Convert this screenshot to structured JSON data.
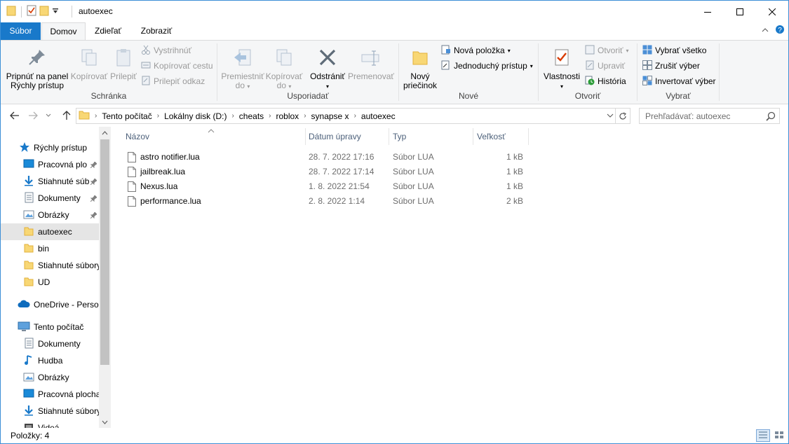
{
  "window": {
    "title": "autoexec",
    "accent": "#1979ca"
  },
  "ribbon_tabs": {
    "file": "Súbor",
    "home": "Domov",
    "share": "Zdieľať",
    "view": "Zobraziť"
  },
  "ribbon": {
    "clipboard": {
      "title": "Schránka",
      "pin_line1": "Pripnúť na panel",
      "pin_line2": "Rýchly prístup",
      "copy": "Kopírovať",
      "paste": "Prilepiť",
      "cut": "Vystrihnúť",
      "copy_path": "Kopírovať cestu",
      "paste_shortcut": "Prilepiť odkaz"
    },
    "organize": {
      "title": "Usporiadať",
      "move_line1": "Premiestniť",
      "move_line2": "do",
      "copy_line1": "Kopírovať",
      "copy_line2": "do",
      "delete": "Odstrániť",
      "rename": "Premenovať"
    },
    "new": {
      "title": "Nové",
      "folder_line1": "Nový",
      "folder_line2": "priečinok",
      "new_item": "Nová položka",
      "easy_access": "Jednoduchý prístup"
    },
    "open": {
      "title": "Otvoriť",
      "properties": "Vlastnosti",
      "open": "Otvoriť",
      "edit": "Upraviť",
      "history": "História"
    },
    "select": {
      "title": "Vybrať",
      "select_all": "Vybrať všetko",
      "select_none": "Zrušiť výber",
      "invert": "Invertovať výber"
    }
  },
  "address": {
    "crumbs": [
      "Tento počítač",
      "Lokálny disk (D:)",
      "cheats",
      "roblox",
      "synapse x",
      "autoexec"
    ],
    "search_placeholder": "Prehľadávať: autoexec"
  },
  "nav": {
    "quick_access": "Rýchly prístup",
    "quick_items": [
      "Pracovná plo",
      "Stiahnuté súb",
      "Dokumenty",
      "Obrázky",
      "autoexec",
      "bin",
      "Stiahnuté súbory",
      "UD"
    ],
    "onedrive": "OneDrive - Persor",
    "this_pc": "Tento počítač",
    "pc_items": [
      "Dokumenty",
      "Hudba",
      "Obrázky",
      "Pracovná plocha",
      "Stiahnuté súbory",
      "Videá"
    ]
  },
  "columns": {
    "name": "Názov",
    "modified": "Dátum úpravy",
    "type": "Typ",
    "size": "Veľkosť"
  },
  "files": [
    {
      "name": "astro notifier.lua",
      "modified": "28. 7. 2022 17:16",
      "type": "Súbor LUA",
      "size": "1 kB"
    },
    {
      "name": "jailbreak.lua",
      "modified": "28. 7. 2022 17:14",
      "type": "Súbor LUA",
      "size": "1 kB"
    },
    {
      "name": "Nexus.lua",
      "modified": "1. 8. 2022 21:54",
      "type": "Súbor LUA",
      "size": "1 kB"
    },
    {
      "name": "performance.lua",
      "modified": "2. 8. 2022 1:14",
      "type": "Súbor LUA",
      "size": "2 kB"
    }
  ],
  "status": {
    "items": "Položky: 4"
  }
}
